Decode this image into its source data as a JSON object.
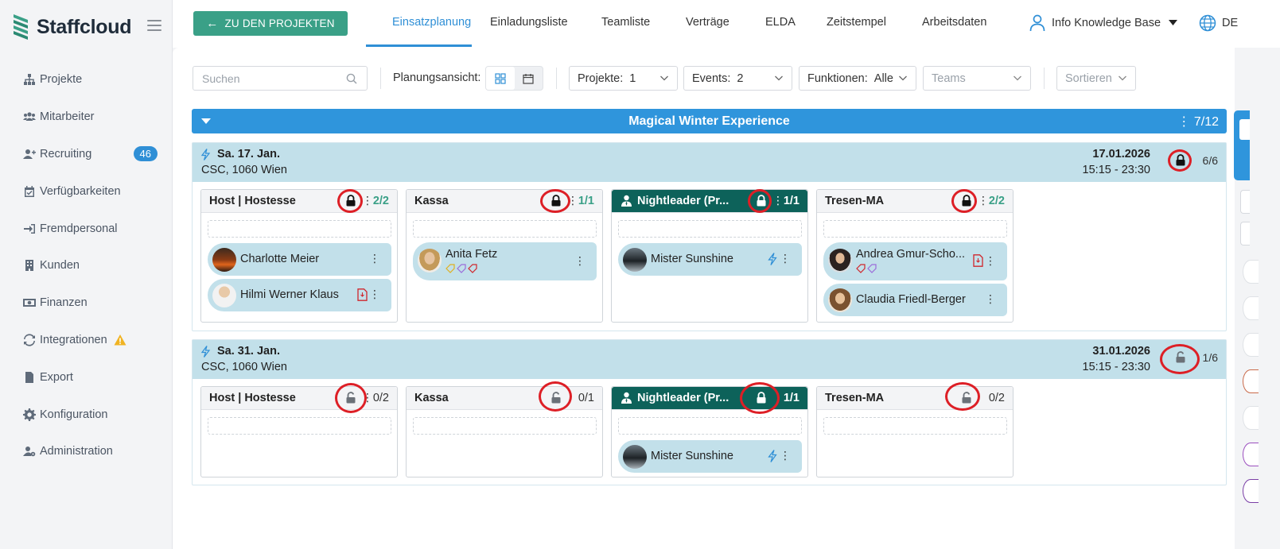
{
  "brand": {
    "name": "Staffcloud",
    "accent": "#2f8fd6",
    "green": "#3aa087",
    "dark_teal": "#0d625a"
  },
  "sidebar": {
    "items": [
      {
        "label": "Projekte",
        "icon": "sitemap-icon"
      },
      {
        "label": "Mitarbeiter",
        "icon": "users-icon"
      },
      {
        "label": "Recruiting",
        "icon": "user-plus-icon",
        "badge": "46"
      },
      {
        "label": "Verfügbarkeiten",
        "icon": "calendar-check-icon"
      },
      {
        "label": "Fremdpersonal",
        "icon": "sign-in-icon"
      },
      {
        "label": "Kunden",
        "icon": "building-icon"
      },
      {
        "label": "Finanzen",
        "icon": "money-icon"
      },
      {
        "label": "Integrationen",
        "icon": "sync-icon",
        "warning": true
      },
      {
        "label": "Export",
        "icon": "file-icon"
      },
      {
        "label": "Konfiguration",
        "icon": "gear-icon"
      },
      {
        "label": "Administration",
        "icon": "user-cog-icon"
      }
    ]
  },
  "topbar": {
    "back_label": "ZU DEN PROJEKTEN",
    "tabs": [
      "Einsatzplanung",
      "Einladungsliste",
      "Teamliste",
      "Verträge",
      "ELDA",
      "Zeitstempel",
      "Arbeitsdaten"
    ],
    "active_tab": "Einsatzplanung",
    "user": "Info Knowledge Base",
    "language": "DE"
  },
  "filters": {
    "search_placeholder": "Suchen",
    "planning_view_label": "Planungsansicht:",
    "projects_label": "Projekte:",
    "projects_value": "1",
    "events_label": "Events:",
    "events_value": "2",
    "functions_label": "Funktionen:",
    "functions_value": "Alle",
    "teams_placeholder": "Teams",
    "sort_placeholder": "Sortieren"
  },
  "project": {
    "title": "Magical Winter Experience",
    "count": "7/12"
  },
  "events": [
    {
      "date": "Sa. 17. Jan.",
      "location": "CSC, 1060 Wien",
      "full_date": "17.01.2026",
      "time": "15:15 - 23:30",
      "ratio": "6/6",
      "locked": true,
      "functions": [
        {
          "name": "Host | Hostesse",
          "ratio": "2/2",
          "locked": true,
          "employees": [
            {
              "name": "Charlotte Meier"
            },
            {
              "name": "Hilmi Werner Klaus",
              "doc": true
            }
          ]
        },
        {
          "name": "Kassa",
          "ratio": "1/1",
          "locked": true,
          "employees": [
            {
              "name": "Anita Fetz",
              "tags": true
            }
          ]
        },
        {
          "name": "Nightleader (Pr...",
          "ratio": "1/1",
          "locked": true,
          "dark": true,
          "employees": [
            {
              "name": "Mister Sunshine",
              "bolt": true
            }
          ]
        },
        {
          "name": "Tresen-MA",
          "ratio": "2/2",
          "locked": true,
          "employees": [
            {
              "name": "Andrea Gmur-Scho...",
              "tags": true,
              "doc": true
            },
            {
              "name": "Claudia Friedl-Berger"
            }
          ]
        }
      ]
    },
    {
      "date": "Sa. 31. Jan.",
      "location": "CSC, 1060 Wien",
      "full_date": "31.01.2026",
      "time": "15:15 - 23:30",
      "ratio": "1/6",
      "locked": false,
      "functions": [
        {
          "name": "Host | Hostesse",
          "ratio": "0/2",
          "locked": false,
          "employees": []
        },
        {
          "name": "Kassa",
          "ratio": "0/1",
          "locked": false,
          "employees": []
        },
        {
          "name": "Nightleader (Pr...",
          "ratio": "1/1",
          "locked": true,
          "dark": true,
          "employees": [
            {
              "name": "Mister Sunshine",
              "bolt": true
            }
          ]
        },
        {
          "name": "Tresen-MA",
          "ratio": "0/2",
          "locked": false,
          "employees": []
        }
      ]
    }
  ]
}
